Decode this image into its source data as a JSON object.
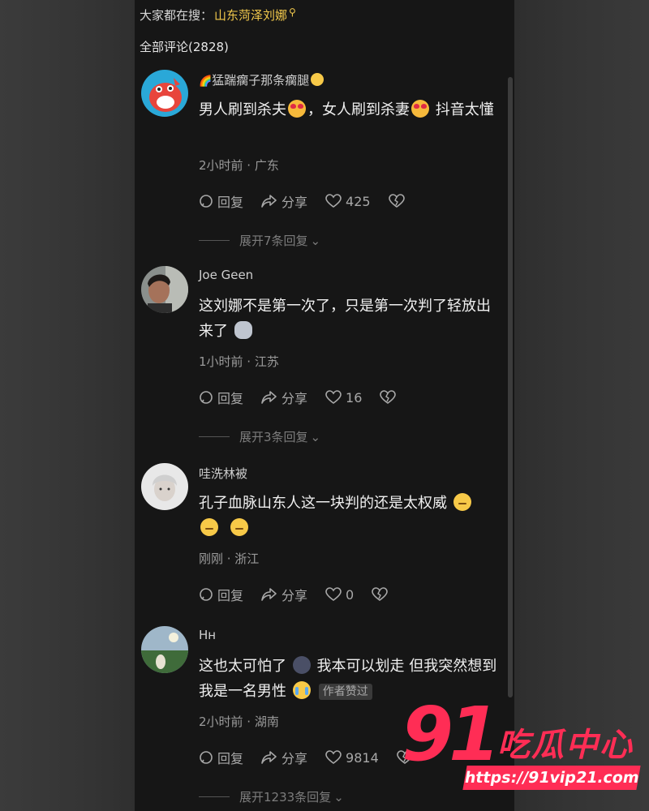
{
  "search": {
    "prefix": "大家都在搜：",
    "keyword": "山东菏泽刘娜"
  },
  "comments_header": {
    "title": "全部评论(2828)"
  },
  "comments": [
    {
      "username": "猛踹瘸子那条瘸腿",
      "text_a": "男人刷到杀夫",
      "text_b": "，女人刷到杀妻",
      "text_c": "抖音太懂",
      "meta": "2小时前 · 广东",
      "reply_label": "回复",
      "share_label": "分享",
      "likes": "425",
      "expand": "展开7条回复"
    },
    {
      "username": "Joe Geen",
      "text_a": "这刘娜不是第一次了，只是第一次判了轻放出来了",
      "meta": "1小时前 · 江苏",
      "reply_label": "回复",
      "share_label": "分享",
      "likes": "16",
      "expand": "展开3条回复"
    },
    {
      "username": "哇洗林被",
      "text_a": "孔子血脉山东人这一块判的还是太权威",
      "meta": "刚刚 · 浙江",
      "reply_label": "回复",
      "share_label": "分享",
      "likes": "0"
    },
    {
      "username": "Hн",
      "text_a": "这也太可怕了",
      "text_b": "我本可以划走 但我突然想到我是一名男性",
      "badge": "作者赞过",
      "meta": "2小时前 · 湖南",
      "reply_label": "回复",
      "share_label": "分享",
      "likes": "9814",
      "expand": "展开1233条回复"
    }
  ],
  "watermark": {
    "number": "91",
    "name": "吃瓜中心",
    "url": "https://91vip21.com"
  },
  "colors": {
    "panel_bg": "#161616",
    "keyword": "#f2c94c",
    "watermark": "#ff2d55"
  }
}
